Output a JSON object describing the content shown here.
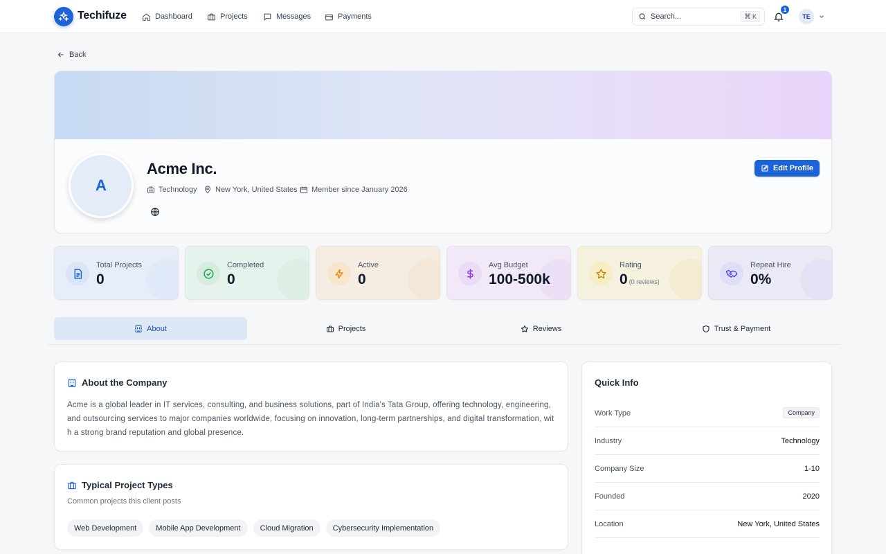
{
  "nav": {
    "brand": "Techifuze",
    "items": [
      {
        "label": "Dashboard",
        "icon": "home-icon"
      },
      {
        "label": "Projects",
        "icon": "briefcase-icon"
      },
      {
        "label": "Messages",
        "icon": "message-icon"
      },
      {
        "label": "Payments",
        "icon": "wallet-icon"
      }
    ],
    "search_placeholder": "Search...",
    "search_shortcut": "K",
    "notification_count": "1",
    "user_initials": "TE"
  },
  "back_label": "Back",
  "profile": {
    "avatar_letter": "A",
    "name": "Acme Inc.",
    "industry": "Technology",
    "location": "New York, United States",
    "member_since": "Member since January 2026",
    "edit_label": "Edit Profile"
  },
  "stats": [
    {
      "label": "Total Projects",
      "value": "0",
      "sub": "",
      "icon": "file-icon",
      "color": "#1d63d8"
    },
    {
      "label": "Completed",
      "value": "0",
      "sub": "",
      "icon": "check-circle-icon",
      "color": "#16a34a"
    },
    {
      "label": "Active",
      "value": "0",
      "sub": "",
      "icon": "lightning-icon",
      "color": "#ea8a0c"
    },
    {
      "label": "Avg Budget",
      "value": "100-500k",
      "sub": "",
      "icon": "dollar-icon",
      "color": "#9333ea"
    },
    {
      "label": "Rating",
      "value": "0",
      "sub": "(0 reviews)",
      "icon": "star-icon",
      "color": "#ca8a04"
    },
    {
      "label": "Repeat Hire",
      "value": "0%",
      "sub": "",
      "icon": "handshake-icon",
      "color": "#4f46e5"
    }
  ],
  "tabs": [
    {
      "label": "About",
      "icon": "building-icon"
    },
    {
      "label": "Projects",
      "icon": "briefcase-icon"
    },
    {
      "label": "Reviews",
      "icon": "star-icon"
    },
    {
      "label": "Trust & Payment",
      "icon": "shield-icon"
    }
  ],
  "about": {
    "title": "About the Company",
    "text": "Acme is a global leader in IT services, consulting, and business solutions, part of India's Tata Group, offering technology, engineering, and outsourcing services to major companies worldwide, focusing on innovation, long-term partnerships, and digital transformation, with a strong brand reputation and global presence."
  },
  "project_types": {
    "title": "Typical Project Types",
    "subtitle": "Common projects this client posts",
    "chips": [
      "Web Development",
      "Mobile App Development",
      "Cloud Migration",
      "Cybersecurity Implementation"
    ]
  },
  "quick_info": {
    "title": "Quick Info",
    "rows": [
      {
        "key": "Work Type",
        "value": "Company"
      },
      {
        "key": "Industry",
        "value": "Technology"
      },
      {
        "key": "Company Size",
        "value": "1-10"
      },
      {
        "key": "Founded",
        "value": "2020"
      },
      {
        "key": "Location",
        "value": "New York, United States"
      }
    ]
  },
  "colors": {
    "accent": "#1d63d8",
    "active_tab_bg": "#dde8f7"
  }
}
